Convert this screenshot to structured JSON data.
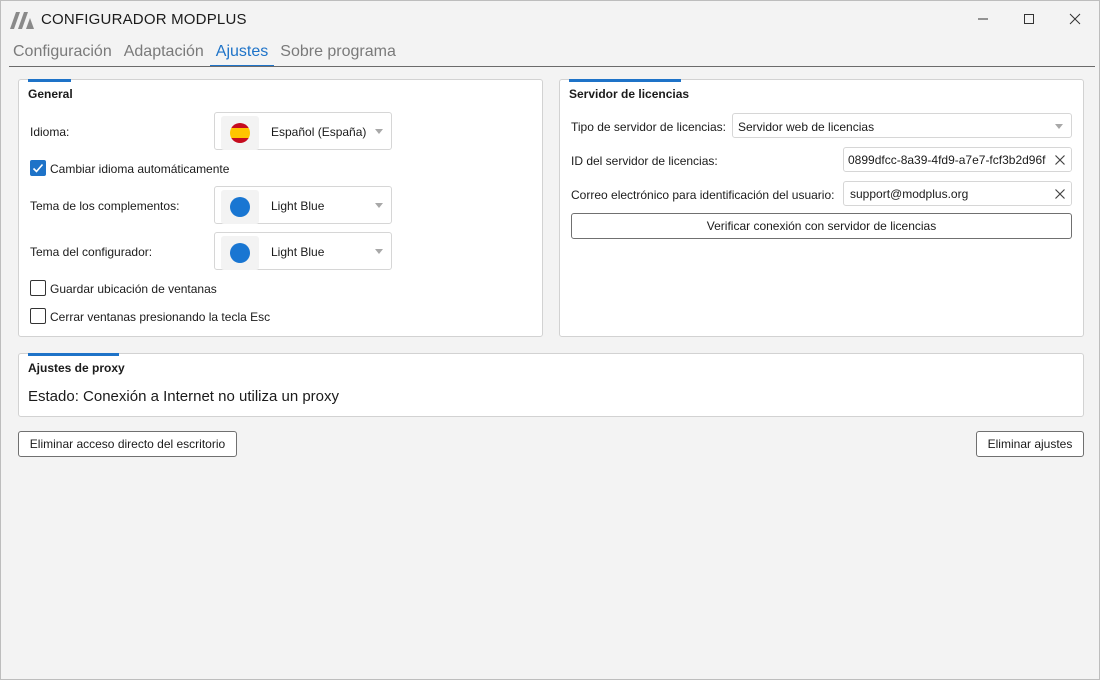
{
  "window": {
    "title": "CONFIGURADOR MODPLUS",
    "logo_icon": "modplus-logo-icon"
  },
  "tabs": [
    {
      "label": "Configuración",
      "active": false
    },
    {
      "label": "Adaptación",
      "active": false
    },
    {
      "label": "Ajustes",
      "active": true
    },
    {
      "label": "Sobre programa",
      "active": false
    }
  ],
  "general": {
    "title": "General",
    "language_label": "Idioma:",
    "language_value": "Español (España)",
    "language_icon": "spain-flag-icon",
    "auto_language_label": "Cambiar idioma automáticamente",
    "auto_language_checked": true,
    "addins_theme_label": "Tema de los complementos:",
    "addins_theme_value": "Light Blue",
    "configurator_theme_label": "Tema del configurador:",
    "configurator_theme_value": "Light Blue",
    "theme_color": "#1976d2",
    "save_windows_label": "Guardar ubicación de ventanas",
    "save_windows_checked": false,
    "close_esc_label": "Cerrar ventanas presionando la tecla Esc",
    "close_esc_checked": false
  },
  "license": {
    "title": "Servidor de licencias",
    "server_type_label": "Tipo de servidor de licencias:",
    "server_type_value": "Servidor web de licencias",
    "server_id_label": "ID del servidor de licencias:",
    "server_id_value": "0899dfcc-8a39-4fd9-a7e7-fcf3b2d96f",
    "email_label": "Correo electrónico para identificación del usuario:",
    "email_value": "support@modplus.org",
    "verify_button": "Verificar conexión con servidor de licencias"
  },
  "proxy": {
    "title": "Ajustes de proxy",
    "status": "Estado: Conexión a Internet no utiliza un proxy"
  },
  "footer": {
    "remove_shortcut_button": "Eliminar acceso directo del escritorio",
    "remove_settings_button": "Eliminar ajustes"
  },
  "colors": {
    "accent": "#1e73c8",
    "background": "#f3f3f3"
  }
}
